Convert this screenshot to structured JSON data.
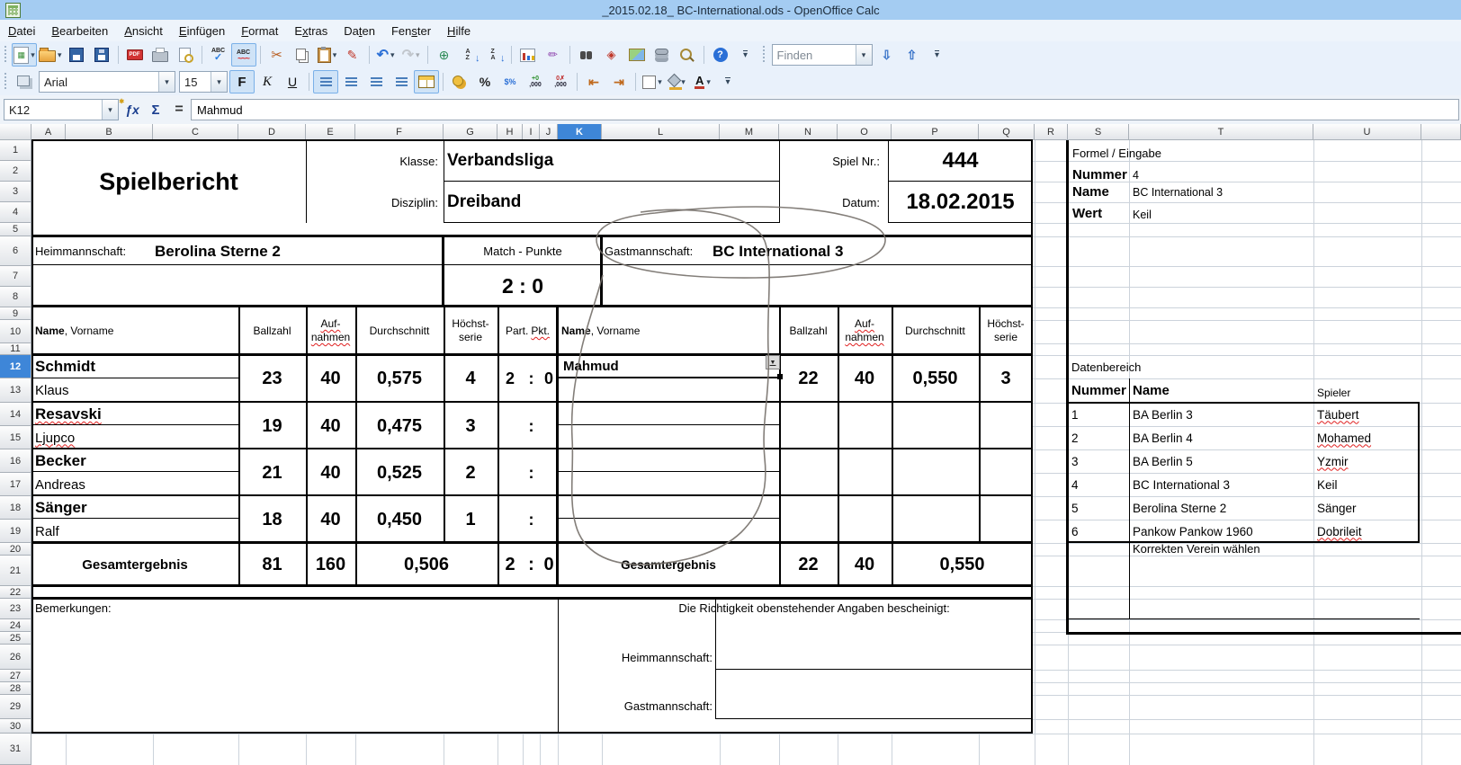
{
  "window": {
    "title": "_2015.02.18_ BC-International.ods - OpenOffice Calc"
  },
  "colors": {
    "titlebar": "#a4ccf2",
    "selection_blue": "#3e86d8",
    "gridline": "#ccd3db",
    "squiggle_red": "#e02020",
    "annotation_pen": "#76706a"
  },
  "menu": [
    {
      "pre": "",
      "accel": "D",
      "post": "atei"
    },
    {
      "pre": "",
      "accel": "B",
      "post": "earbeiten"
    },
    {
      "pre": "",
      "accel": "A",
      "post": "nsicht"
    },
    {
      "pre": "",
      "accel": "E",
      "post": "infügen"
    },
    {
      "pre": "",
      "accel": "F",
      "post": "ormat"
    },
    {
      "pre": "E",
      "accel": "x",
      "post": "tras"
    },
    {
      "pre": "Da",
      "accel": "t",
      "post": "en"
    },
    {
      "pre": "Fen",
      "accel": "s",
      "post": "ter"
    },
    {
      "pre": "",
      "accel": "H",
      "post": "ilfe"
    }
  ],
  "toolbar_std": [
    {
      "type": "icon",
      "name": "new-document",
      "glyph": "▦",
      "cls": "ic-new",
      "dropdown": true,
      "active": true
    },
    {
      "type": "icon",
      "name": "open",
      "glyph": "",
      "cls": "ic-open",
      "dropdown": true
    },
    {
      "type": "icon",
      "name": "save",
      "glyph": "",
      "cls": "ic-save"
    },
    {
      "type": "icon",
      "name": "save-as",
      "glyph": "",
      "cls": "ic-save2"
    },
    {
      "type": "sep"
    },
    {
      "type": "icon",
      "name": "export-pdf",
      "glyph": "PDF",
      "cls": "ic-pdf"
    },
    {
      "type": "icon",
      "name": "print",
      "glyph": "",
      "cls": "ic-print"
    },
    {
      "type": "icon",
      "name": "page-preview",
      "glyph": "",
      "cls": "ic-prev"
    },
    {
      "type": "sep"
    },
    {
      "type": "icon",
      "name": "spellcheck",
      "glyph": "ABC",
      "cls": "ic-abc"
    },
    {
      "type": "icon",
      "name": "auto-spellcheck",
      "glyph": "ABC",
      "cls": "ic-abcw",
      "active": true
    },
    {
      "type": "sep"
    },
    {
      "type": "icon",
      "name": "cut",
      "glyph": "✂",
      "cls": "ic-cut"
    },
    {
      "type": "icon",
      "name": "copy",
      "glyph": "",
      "cls": "ic-copy"
    },
    {
      "type": "icon",
      "name": "paste",
      "glyph": "",
      "cls": "ic-paste",
      "dropdown": true
    },
    {
      "type": "icon",
      "name": "format-paintbrush",
      "glyph": "✎",
      "cls": "ic-brush"
    },
    {
      "type": "sep"
    },
    {
      "type": "icon",
      "name": "undo",
      "glyph": "↶",
      "cls": "ic-undo",
      "dropdown": true
    },
    {
      "type": "icon",
      "name": "redo",
      "glyph": "↷",
      "cls": "ic-redo",
      "dropdown": true,
      "disabled": true
    },
    {
      "type": "sep"
    },
    {
      "type": "icon",
      "name": "hyperlink",
      "glyph": "⊕",
      "cls": "ic-link"
    },
    {
      "type": "icon",
      "name": "sort-ascending",
      "glyph": "AZ",
      "cls": "ic-sort"
    },
    {
      "type": "icon",
      "name": "sort-descending",
      "glyph": "ZA",
      "cls": "ic-sort"
    },
    {
      "type": "sep"
    },
    {
      "type": "icon",
      "name": "insert-chart",
      "glyph": "",
      "cls": "ic-chart"
    },
    {
      "type": "icon",
      "name": "show-draw-functions",
      "glyph": "✏",
      "cls": "ic-draw"
    },
    {
      "type": "sep"
    },
    {
      "type": "icon",
      "name": "find-and-replace",
      "glyph": "",
      "cls": "ic-find"
    },
    {
      "type": "icon",
      "name": "navigator",
      "glyph": "◈",
      "cls": "ic-nav"
    },
    {
      "type": "icon",
      "name": "gallery",
      "glyph": "",
      "cls": "ic-gallery"
    },
    {
      "type": "icon",
      "name": "data-sources",
      "glyph": "",
      "cls": "ic-db"
    },
    {
      "type": "icon",
      "name": "zoom",
      "glyph": "",
      "cls": "ic-zoom"
    },
    {
      "type": "sep"
    },
    {
      "type": "icon",
      "name": "help",
      "glyph": "?",
      "cls": "ic-help"
    },
    {
      "type": "icon",
      "name": "toolbar-overflow",
      "glyph": "▾",
      "cls": "ic-ovf"
    }
  ],
  "toolbar_find": {
    "value": "Finden",
    "buttons": [
      {
        "name": "find-next",
        "glyph": "⇩"
      },
      {
        "name": "find-previous",
        "glyph": "⇧"
      },
      {
        "name": "toolbar-overflow",
        "glyph": "▾"
      }
    ]
  },
  "toolbar_fmt": [
    {
      "type": "icon",
      "name": "styles-window",
      "glyph": "",
      "cls": "ic-styles"
    },
    {
      "type": "combo",
      "name": "font-name-combo",
      "value": "Arial",
      "width": 150
    },
    {
      "type": "combo",
      "name": "font-size-combo",
      "value": "15",
      "width": 52
    },
    {
      "type": "icon",
      "name": "bold",
      "glyph": "F",
      "cls": "btn-bold",
      "active": true
    },
    {
      "type": "icon",
      "name": "italic",
      "glyph": "K",
      "cls": "btn-italic"
    },
    {
      "type": "icon",
      "name": "underline",
      "glyph": "U",
      "cls": "btn-under"
    },
    {
      "type": "sep"
    },
    {
      "type": "icon",
      "name": "align-left",
      "glyph": "",
      "cls": "ic-al al-l",
      "active": true
    },
    {
      "type": "icon",
      "name": "align-center",
      "glyph": "",
      "cls": "ic-al al-c"
    },
    {
      "type": "icon",
      "name": "align-right",
      "glyph": "",
      "cls": "ic-al al-r"
    },
    {
      "type": "icon",
      "name": "align-justify",
      "glyph": "",
      "cls": "ic-al al-j"
    },
    {
      "type": "icon",
      "name": "merge-cells",
      "glyph": "",
      "cls": "ic-merge",
      "active": true
    },
    {
      "type": "sep"
    },
    {
      "type": "icon",
      "name": "number-format-currency",
      "glyph": "",
      "cls": "ic-coins"
    },
    {
      "type": "icon",
      "name": "number-format-percent",
      "glyph": "%",
      "cls": "ic-pct"
    },
    {
      "type": "icon",
      "name": "number-format-standard",
      "glyph": "$%",
      "cls": "ic-std"
    },
    {
      "type": "icon",
      "name": "add-decimal-place",
      "glyph": "+0|,000",
      "cls": "ic-addd"
    },
    {
      "type": "icon",
      "name": "delete-decimal-place",
      "glyph": "0✗|,000",
      "cls": "ic-deld"
    },
    {
      "type": "sep"
    },
    {
      "type": "icon",
      "name": "decrease-indent",
      "glyph": "⇤",
      "cls": "ic-ind"
    },
    {
      "type": "icon",
      "name": "increase-indent",
      "glyph": "⇥",
      "cls": "ic-ind"
    },
    {
      "type": "sep"
    },
    {
      "type": "icon",
      "name": "borders",
      "glyph": "",
      "cls": "ic-borders",
      "dropdown": true
    },
    {
      "type": "icon",
      "name": "background-color",
      "glyph": "",
      "cls": "ic-bg",
      "dropdown": true
    },
    {
      "type": "icon",
      "name": "font-color",
      "glyph": "A",
      "cls": "ic-fontcolor",
      "dropdown": true
    },
    {
      "type": "icon",
      "name": "toolbar-overflow",
      "glyph": "▾",
      "cls": "ic-ovf"
    }
  ],
  "formula_bar": {
    "cell_ref": "K12",
    "input": "Mahmud"
  },
  "grid": {
    "columns": [
      "A",
      "B",
      "C",
      "D",
      "E",
      "F",
      "G",
      "H",
      "I",
      "J",
      "K",
      "L",
      "M",
      "N",
      "O",
      "P",
      "Q",
      "R",
      "S",
      "T",
      "U"
    ],
    "selected_column": "K",
    "row_labels": [
      "1",
      "2",
      "3",
      "4",
      "5",
      "6",
      "7",
      "8",
      "9",
      "10",
      "11",
      "12",
      "13",
      "14",
      "15",
      "16",
      "17",
      "18",
      "19",
      "20",
      "21",
      "22",
      "23",
      "24",
      "25",
      "26",
      "27",
      "28",
      "29",
      "30",
      "31"
    ],
    "selected_row": "12"
  },
  "form": {
    "title": "Spielbericht",
    "klasse_label": "Klasse:",
    "klasse_value": "Verbandsliga",
    "disziplin_label": "Disziplin:",
    "disziplin_value": "Dreiband",
    "spielnr_label": "Spiel Nr.:",
    "spielnr_value": "444",
    "datum_label": "Datum:",
    "datum_value": "18.02.2015",
    "heim_label": "Heimmannschaft:",
    "heim_value": "Berolina Sterne 2",
    "match_label": "Match - Punkte",
    "match_score": "2 : 0",
    "gast_label": "Gastmannschaft:",
    "gast_value": "BC International 3",
    "table": {
      "name_bold": "Name",
      "name_rest": ", Vorname",
      "col_ballzahl": "Ballzahl",
      "col_aufnahmen": [
        "Auf-",
        "nahmen"
      ],
      "col_durchschnitt": "Durchschnitt",
      "col_serie": [
        "Höchst-",
        "serie"
      ],
      "col_part_1": "Part.",
      "col_part_2": "Pkt.",
      "home_players": [
        {
          "last": "Schmidt",
          "first": "Klaus",
          "last_sq": false,
          "first_sq": false,
          "ballzahl": "23",
          "aufnahmen": "40",
          "durchschnitt": "0,575",
          "serie": "4",
          "part": [
            "2",
            ":",
            "0"
          ]
        },
        {
          "last": "Resavski",
          "first": "Ljupco",
          "last_sq": true,
          "first_sq": true,
          "ballzahl": "19",
          "aufnahmen": "40",
          "durchschnitt": "0,475",
          "serie": "3",
          "part": [
            "",
            ":",
            ""
          ]
        },
        {
          "last": "Becker",
          "first": "Andreas",
          "last_sq": false,
          "first_sq": false,
          "ballzahl": "21",
          "aufnahmen": "40",
          "durchschnitt": "0,525",
          "serie": "2",
          "part": [
            "",
            ":",
            ""
          ]
        },
        {
          "last": "Sänger",
          "first": "Ralf",
          "last_sq": false,
          "first_sq": false,
          "ballzahl": "18",
          "aufnahmen": "40",
          "durchschnitt": "0,450",
          "serie": "1",
          "part": [
            "",
            ":",
            ""
          ]
        }
      ],
      "guest_players": [
        {
          "last": "Mahmud",
          "ballzahl": "22",
          "aufnahmen": "40",
          "durchschnitt": "0,550",
          "serie": "3"
        },
        {
          "last": "",
          "ballzahl": "",
          "aufnahmen": "",
          "durchschnitt": "",
          "serie": ""
        },
        {
          "last": "",
          "ballzahl": "",
          "aufnahmen": "",
          "durchschnitt": "",
          "serie": ""
        },
        {
          "last": "",
          "ballzahl": "",
          "aufnahmen": "",
          "durchschnitt": "",
          "serie": ""
        }
      ],
      "total_label": "Gesamtergebnis",
      "home_total": {
        "ballzahl": "81",
        "aufnahmen": "160",
        "durchschnitt": "0,506",
        "part": [
          "2",
          ":",
          "0"
        ]
      },
      "guest_total": {
        "ballzahl": "22",
        "aufnahmen": "40",
        "durchschnitt": "0,550"
      }
    },
    "footer": {
      "bemerkungen": "Bemerkungen:",
      "richtigkeit": "Die Richtigkeit obenstehender Angaben bescheinigt:",
      "heim_sig": "Heimmannschaft:",
      "gast_sig": "Gastmannschaft:"
    }
  },
  "panel": {
    "formel_title": "Formel / Eingabe",
    "formel_rows": [
      {
        "label": "Nummer",
        "value": "4"
      },
      {
        "label": "Name",
        "value": "BC International 3"
      },
      {
        "label": "Wert",
        "value": "Keil"
      }
    ],
    "daten_title": "Datenbereich",
    "daten_headers": {
      "nummer": "Nummer",
      "name": "Name",
      "spieler": "Spieler"
    },
    "daten_rows": [
      {
        "nr": "1",
        "name": "BA Berlin 3",
        "spieler": "Täubert",
        "sq": true
      },
      {
        "nr": "2",
        "name": "BA Berlin 4",
        "spieler": "Mohamed",
        "sq": true
      },
      {
        "nr": "3",
        "name": "BA Berlin 5",
        "spieler": "Yzmir",
        "sq": true
      },
      {
        "nr": "4",
        "name": "BC International 3",
        "spieler": "Keil",
        "sq": false
      },
      {
        "nr": "5",
        "name": "Berolina Sterne 2",
        "spieler": "Sänger",
        "sq": false
      },
      {
        "nr": "6",
        "name": "Pankow Pankow 1960",
        "spieler": "Dobrileit",
        "sq": true
      }
    ],
    "hint": "Korrekten Verein wählen"
  }
}
